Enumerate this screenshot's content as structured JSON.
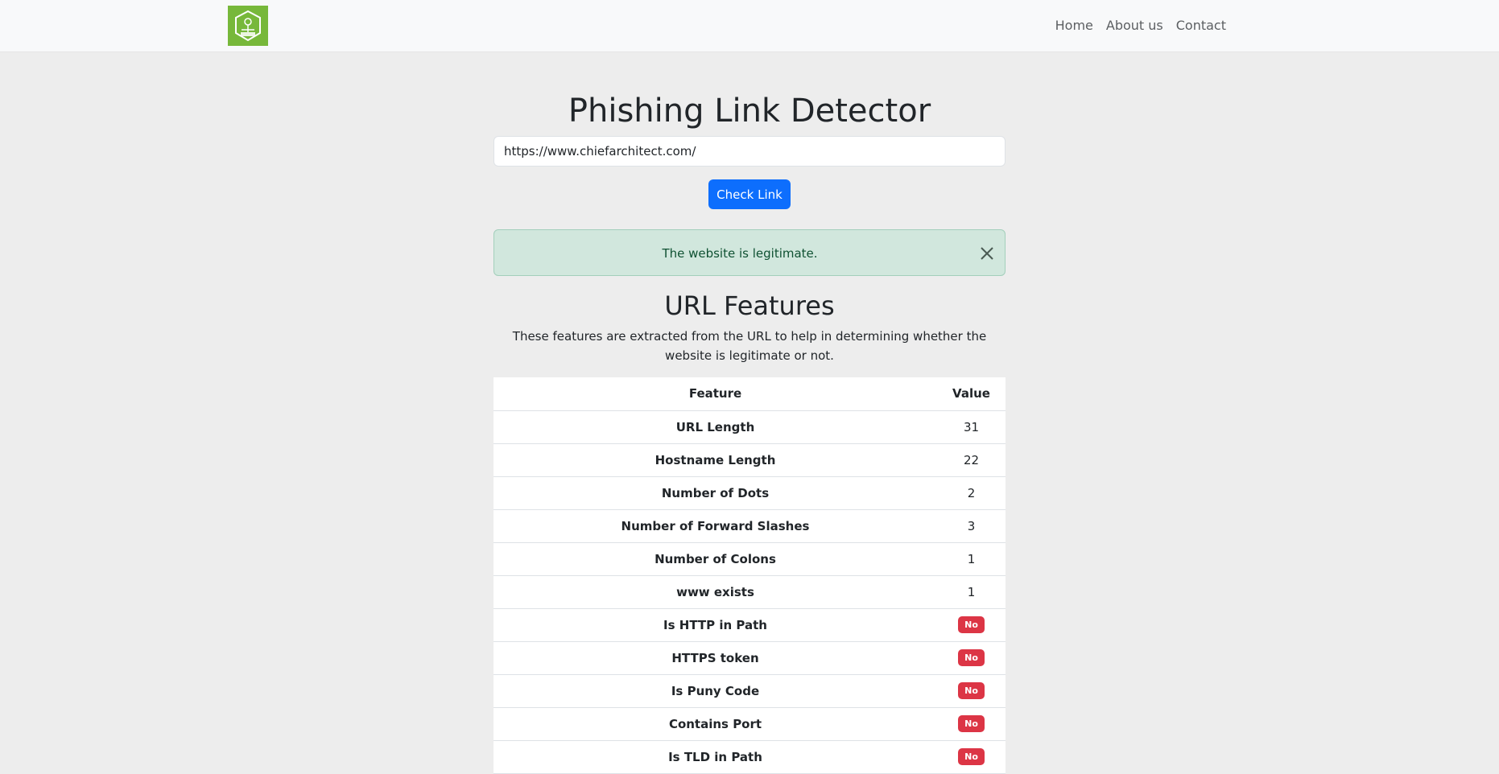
{
  "navbar": {
    "links": [
      "Home",
      "About us",
      "Contact"
    ],
    "brand_color": "#77b83a"
  },
  "main": {
    "title": "Phishing Link Detector",
    "url_value": "https://www.chiefarchitect.com/",
    "check_button_label": "Check Link",
    "accent_color": "#0d6efd"
  },
  "alert": {
    "message": "The website is legitimate.",
    "close_icon": "close-icon",
    "color": "#d1e7dd"
  },
  "features": {
    "title": "URL Features",
    "description": "These features are extracted from the URL to help in determining whether the website is legitimate or not.",
    "headers": [
      "Feature",
      "Value"
    ],
    "rows": [
      {
        "feature": "URL Length",
        "value": "31",
        "badge": false
      },
      {
        "feature": "Hostname Length",
        "value": "22",
        "badge": false
      },
      {
        "feature": "Number of Dots",
        "value": "2",
        "badge": false
      },
      {
        "feature": "Number of Forward Slashes",
        "value": "3",
        "badge": false
      },
      {
        "feature": "Number of Colons",
        "value": "1",
        "badge": false
      },
      {
        "feature": "www exists",
        "value": "1",
        "badge": false
      },
      {
        "feature": "Is HTTP in Path",
        "value": "No",
        "badge": true
      },
      {
        "feature": "HTTPS token",
        "value": "No",
        "badge": true
      },
      {
        "feature": "Is Puny Code",
        "value": "No",
        "badge": true
      },
      {
        "feature": "Contains Port",
        "value": "No",
        "badge": true
      },
      {
        "feature": "Is TLD in Path",
        "value": "No",
        "badge": true
      }
    ],
    "badge_color": "#dc3545"
  }
}
